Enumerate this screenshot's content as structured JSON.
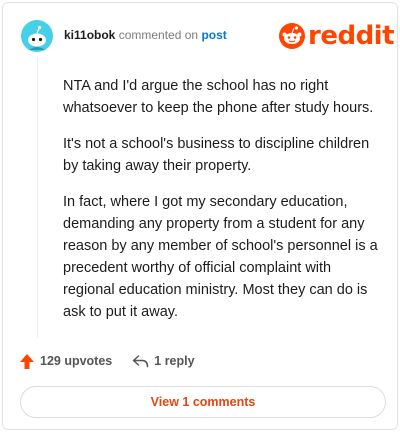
{
  "header": {
    "username": "ki11obok",
    "action_text": "commented on",
    "target_link": "post",
    "brand": "reddit"
  },
  "comment": {
    "paragraphs": [
      "NTA and I'd argue the school has no right whatsoever to keep the phone after study hours.",
      "It's not a school's business to discipline children by taking away their property.",
      "In fact, where I got my secondary education, demanding any property from a student for any reason by any member of school's personnel is a precedent worthy of official complaint with regional education ministry. Most they can do is ask to put it away."
    ]
  },
  "actions": {
    "upvotes": "129 upvotes",
    "replies": "1 reply"
  },
  "footer": {
    "view_comments": "View 1 comments"
  },
  "colors": {
    "accent": "#ff4500",
    "link": "#0079d3",
    "view_button": "#e34613",
    "avatar_bg": "#46d0e8"
  },
  "icons": [
    "reddit-avatar-icon",
    "reddit-logo-icon",
    "upvote-arrow-icon",
    "reply-arrow-icon"
  ]
}
